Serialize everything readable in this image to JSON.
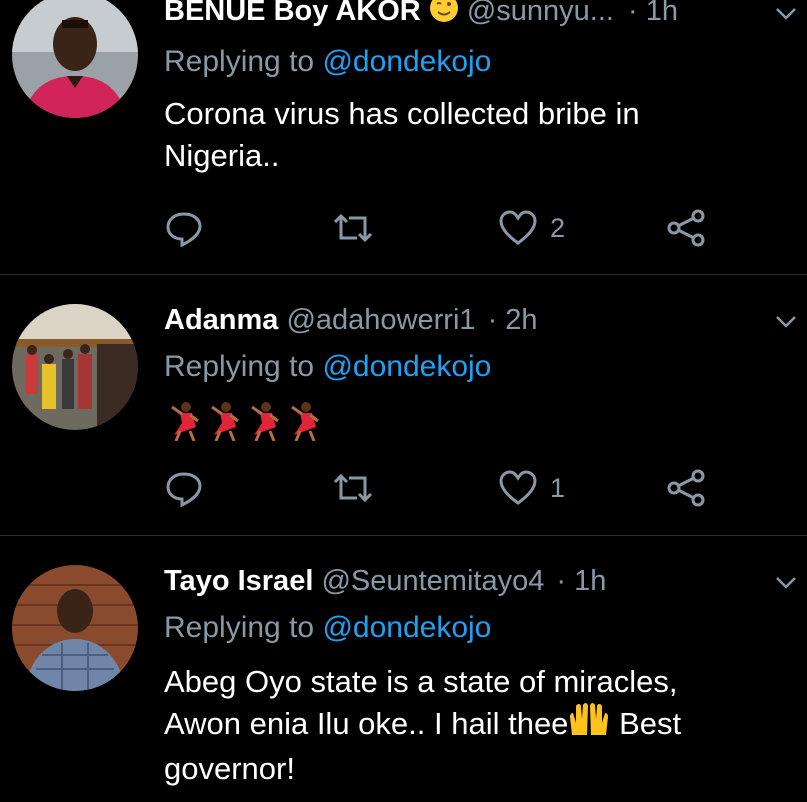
{
  "tweets": [
    {
      "name": "BENUE Boy AKOR",
      "handle": "@sunnyu...",
      "time": "· 1h",
      "replying_prefix": "Replying to",
      "replying_to": "@dondekojo",
      "text_lines": [
        "Corona virus has collected bribe in",
        "Nigeria.."
      ],
      "like_count": "2",
      "name_emoji": "winking-face-emoji"
    },
    {
      "name": "Adanma",
      "handle": "@adahowerri1",
      "time": "· 2h",
      "replying_prefix": "Replying to",
      "replying_to": "@dondekojo",
      "body_emojis": [
        "dancer-emoji",
        "dancer-emoji",
        "dancer-emoji",
        "dancer-emoji"
      ],
      "like_count": "1"
    },
    {
      "name": "Tayo Israel",
      "handle": "@Seuntemitayo4",
      "time": "· 1h",
      "replying_prefix": "Replying to",
      "replying_to": "@dondekojo",
      "text_lines": [
        "Abeg Oyo state is a state of miracles,",
        "Awon enia Ilu oke.. I hail thee",
        "Best",
        "governor!"
      ],
      "body_emoji": "raising-hands-emoji"
    }
  ],
  "colors": {
    "background": "#000000",
    "secondary_text": "#8899a6",
    "link": "#1da1f2",
    "divider": "#2a2f33"
  }
}
